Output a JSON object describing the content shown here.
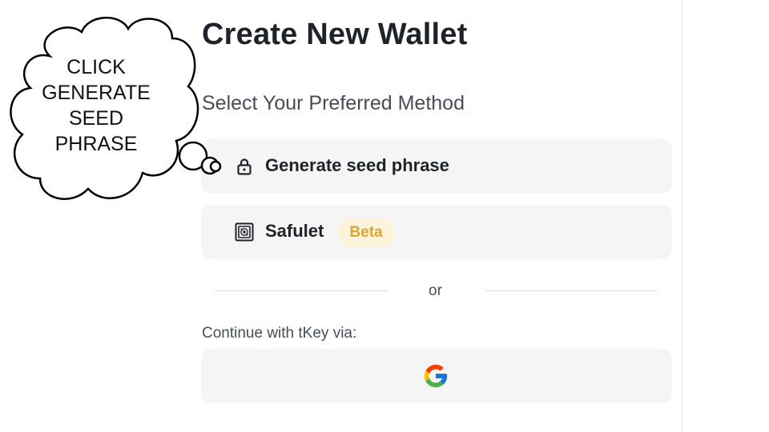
{
  "page": {
    "title": "Create New Wallet",
    "subtitle": "Select Your Preferred Method"
  },
  "options": [
    {
      "label": "Generate seed phrase",
      "icon": "lock-icon"
    },
    {
      "label": "Safulet",
      "icon": "safulet-chip-icon",
      "badge": "Beta"
    }
  ],
  "divider": {
    "text": "or"
  },
  "tkey": {
    "label": "Continue with tKey via:",
    "provider_icon": "google-icon"
  },
  "callout": {
    "lines": [
      "CLICK",
      "GENERATE",
      "SEED",
      "PHRASE"
    ]
  },
  "colors": {
    "title": "#1e2329",
    "option_bg": "#f5f5f5",
    "badge_bg": "#fdf3d8",
    "badge_text": "#d9a73b",
    "google_blue": "#4285F4",
    "google_red": "#EA4335",
    "google_yellow": "#FBBC05",
    "google_green": "#34A853"
  }
}
